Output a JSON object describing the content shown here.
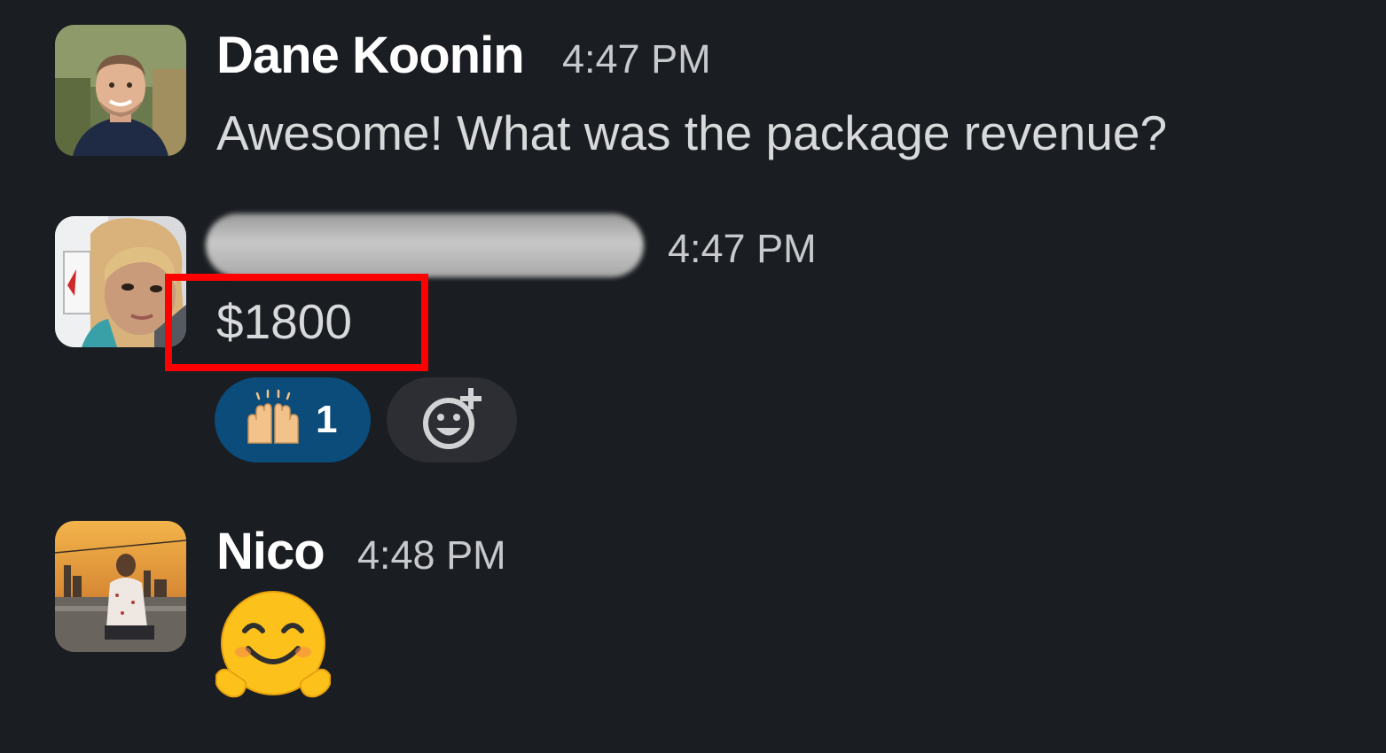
{
  "messages": [
    {
      "author": "Dane Koonin",
      "time": "4:47 PM",
      "text": "Awesome! What was the package revenue?"
    },
    {
      "author": "",
      "time": "4:47 PM",
      "text": "$1800",
      "reactions": [
        {
          "emoji": "raising-hands-icon",
          "count": "1"
        }
      ]
    },
    {
      "author": "Nico",
      "time": "4:48 PM",
      "emoji": "hugging-face-icon"
    }
  ],
  "colors": {
    "background": "#1a1d21",
    "reaction_active": "#0b4c7a",
    "highlight": "#ff0000"
  }
}
